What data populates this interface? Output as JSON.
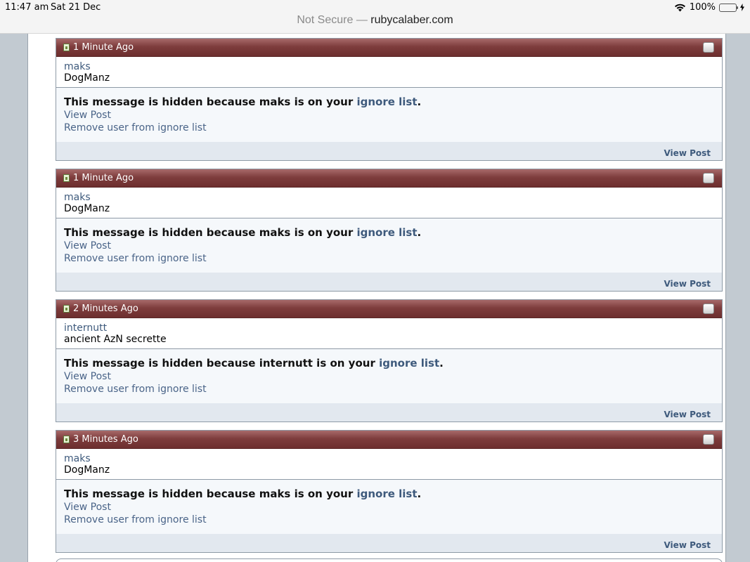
{
  "status_bar": {
    "time": "11:47 am",
    "date": "Sat 21 Dec",
    "battery": "100%",
    "battery_level_percent": 100
  },
  "address_bar": {
    "security": "Not Secure —",
    "domain": "rubycalaber.com"
  },
  "posts": [
    {
      "time": "1 Minute Ago",
      "username": "maks",
      "user_title": "DogManz",
      "hidden_prefix": "This message is hidden because maks is on your ",
      "ignore_link": "ignore list",
      "hidden_suffix": ".",
      "view_post": "View Post",
      "remove_user": "Remove user from ignore list",
      "footer_view_post": "View Post"
    },
    {
      "time": "1 Minute Ago",
      "username": "maks",
      "user_title": "DogManz",
      "hidden_prefix": "This message is hidden because maks is on your ",
      "ignore_link": "ignore list",
      "hidden_suffix": ".",
      "view_post": "View Post",
      "remove_user": "Remove user from ignore list",
      "footer_view_post": "View Post"
    },
    {
      "time": "2 Minutes Ago",
      "username": "internutt",
      "user_title": "ancient AzN secrette",
      "hidden_prefix": "This message is hidden because internutt is on your ",
      "ignore_link": "ignore list",
      "hidden_suffix": ".",
      "view_post": "View Post",
      "remove_user": "Remove user from ignore list",
      "footer_view_post": "View Post"
    },
    {
      "time": "3 Minutes Ago",
      "username": "maks",
      "user_title": "DogManz",
      "hidden_prefix": "This message is hidden because maks is on your ",
      "ignore_link": "ignore list",
      "hidden_suffix": ".",
      "view_post": "View Post",
      "remove_user": "Remove user from ignore list",
      "footer_view_post": "View Post"
    }
  ],
  "colors": {
    "post_header": "#7e3d3d",
    "link": "#3e5a7c",
    "footer": "#e2e8ef"
  },
  "icons": {
    "post_icon": "document-icon",
    "select": "checkbox-icon",
    "wifi": "wifi-icon",
    "battery": "battery-icon",
    "charging": "charging-icon"
  }
}
